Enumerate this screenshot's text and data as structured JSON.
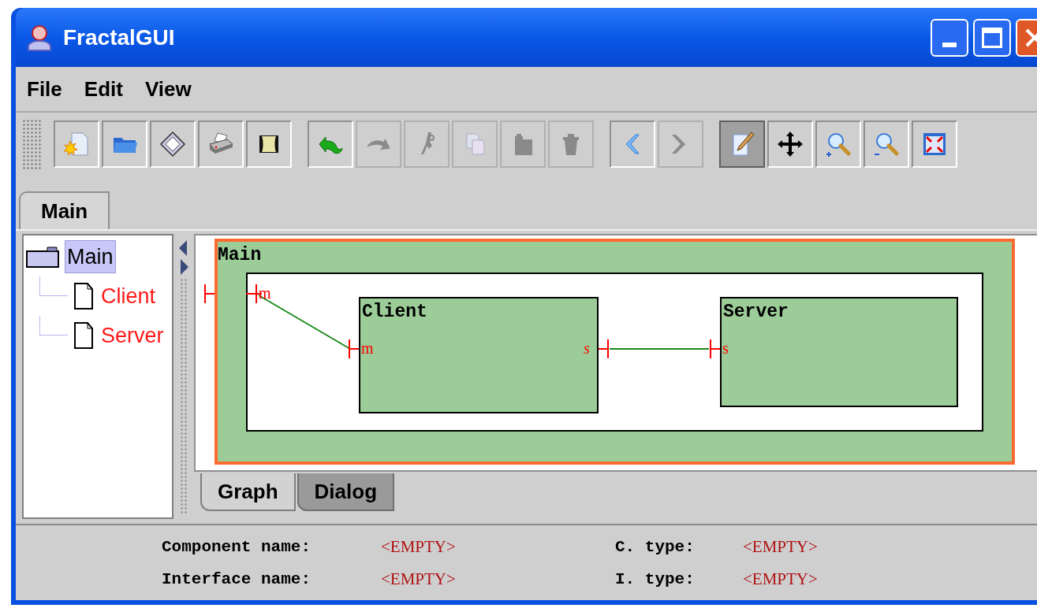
{
  "window": {
    "title": "FractalGUI"
  },
  "menu": [
    "File",
    "Edit",
    "View"
  ],
  "toolbar": [
    [
      {
        "kind": "new",
        "disabled": false,
        "selected": false
      },
      {
        "kind": "open",
        "disabled": false,
        "selected": false
      },
      {
        "kind": "save",
        "disabled": false,
        "selected": false
      },
      {
        "kind": "print",
        "disabled": false,
        "selected": false
      },
      {
        "kind": "scroll",
        "disabled": false,
        "selected": false
      }
    ],
    [
      {
        "kind": "undo",
        "disabled": false,
        "selected": false
      },
      {
        "kind": "redo",
        "disabled": true,
        "selected": false
      },
      {
        "kind": "cut",
        "disabled": true,
        "selected": false
      },
      {
        "kind": "copy",
        "disabled": true,
        "selected": false
      },
      {
        "kind": "paste",
        "disabled": true,
        "selected": false
      },
      {
        "kind": "delete",
        "disabled": true,
        "selected": false
      }
    ],
    [
      {
        "kind": "back",
        "disabled": false,
        "selected": false
      },
      {
        "kind": "forward",
        "disabled": true,
        "selected": false
      }
    ],
    [
      {
        "kind": "edit",
        "disabled": false,
        "selected": true
      },
      {
        "kind": "move",
        "disabled": false,
        "selected": false
      },
      {
        "kind": "zoom-in",
        "disabled": false,
        "selected": false
      },
      {
        "kind": "zoom-out",
        "disabled": false,
        "selected": false
      },
      {
        "kind": "fit",
        "disabled": false,
        "selected": false
      }
    ]
  ],
  "tabs": [
    {
      "label": "Main",
      "selected": true
    }
  ],
  "tree": [
    {
      "label": "Main",
      "kind": "composite",
      "selected": true,
      "children": [
        {
          "label": "Client",
          "kind": "primitive",
          "selected": false
        },
        {
          "label": "Server",
          "kind": "primitive",
          "selected": false
        }
      ]
    }
  ],
  "diagram": {
    "composite": {
      "label": "Main",
      "inner_port": "m"
    },
    "components": [
      {
        "label": "Client",
        "left_port": "m",
        "right_port": "s"
      },
      {
        "label": "Server",
        "left_port": "s"
      }
    ]
  },
  "view_tabs": [
    {
      "label": "Graph",
      "selected": true
    },
    {
      "label": "Dialog",
      "selected": false
    }
  ],
  "info": [
    {
      "label": "Component name:",
      "value": "<EMPTY>"
    },
    {
      "label": "C. type:",
      "value": "<EMPTY>"
    },
    {
      "label": "Interface name:",
      "value": "<EMPTY>"
    },
    {
      "label": "I. type:",
      "value": "<EMPTY>"
    }
  ]
}
